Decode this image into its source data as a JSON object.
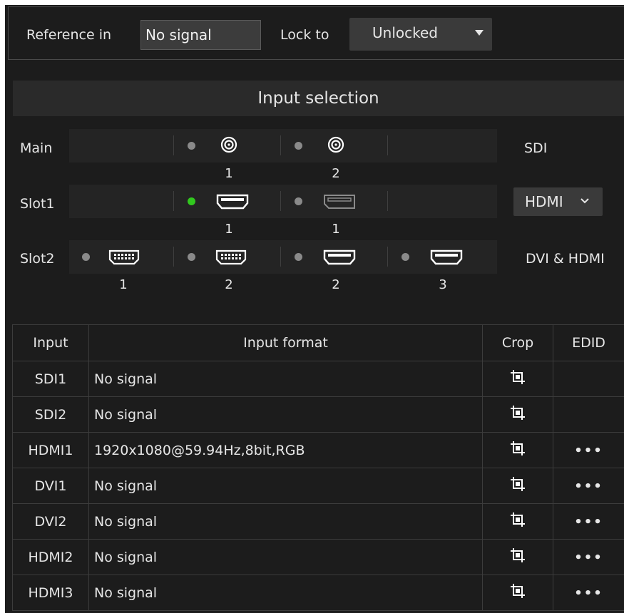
{
  "reference": {
    "label": "Reference in",
    "value": "No signal",
    "lock_label": "Lock to",
    "lock_value": "Unlocked"
  },
  "input_selection": {
    "title": "Input selection",
    "rows": [
      {
        "label": "Main",
        "type_label": "SDI",
        "ports": [
          {
            "icon": "sdi-bnc-icon",
            "number": "1",
            "active": false
          },
          {
            "icon": "sdi-bnc-icon",
            "number": "2",
            "active": false
          }
        ]
      },
      {
        "label": "Slot1",
        "type_label": "HDMI",
        "ports": [
          {
            "icon": "hdmi-port-icon",
            "number": "1",
            "active": true
          },
          {
            "icon": "displayport-icon",
            "number": "1",
            "active": false
          }
        ]
      },
      {
        "label": "Slot2",
        "type_label": "DVI & HDMI",
        "ports": [
          {
            "icon": "dvi-port-icon",
            "number": "1",
            "active": false
          },
          {
            "icon": "dvi-port-icon",
            "number": "2",
            "active": false
          },
          {
            "icon": "hdmi-port-icon",
            "number": "2",
            "active": false
          },
          {
            "icon": "hdmi-port-icon",
            "number": "3",
            "active": false
          }
        ]
      }
    ]
  },
  "table": {
    "headers": [
      "Input",
      "Input format",
      "Crop",
      "EDID"
    ],
    "rows": [
      {
        "input": "SDI1",
        "format": "No signal",
        "edid": ""
      },
      {
        "input": "SDI2",
        "format": "No signal",
        "edid": ""
      },
      {
        "input": "HDMI1",
        "format": "1920x1080@59.94Hz,8bit,RGB",
        "edid": "•••"
      },
      {
        "input": "DVI1",
        "format": "No signal",
        "edid": "•••"
      },
      {
        "input": "DVI2",
        "format": "No signal",
        "edid": "•••"
      },
      {
        "input": "HDMI2",
        "format": "No signal",
        "edid": "•••"
      },
      {
        "input": "HDMI3",
        "format": "No signal",
        "edid": "•••"
      }
    ]
  },
  "colors": {
    "background": "#1c1c1c",
    "active_led": "#31c81e",
    "inactive_led": "#8a8a8a"
  }
}
